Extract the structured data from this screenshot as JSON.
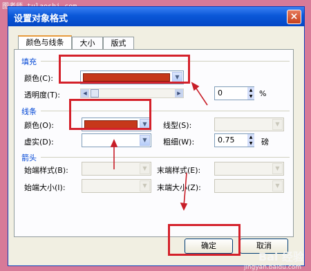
{
  "watermark": {
    "site": "图老师 tulaoshi.com",
    "brand": "Bai 经验",
    "url": "jingyan.baidu.com"
  },
  "dialog": {
    "title": "设置对象格式",
    "close_glyph": "×",
    "tabs": [
      {
        "label": "颜色与线条",
        "active": true
      },
      {
        "label": "大小",
        "active": false
      },
      {
        "label": "版式",
        "active": false
      }
    ],
    "fill": {
      "group": "填充",
      "color_label": "颜色(C):",
      "color_value": "#c6381a",
      "transparency_label": "透明度(T):",
      "transparency_value": "0",
      "transparency_unit": "%"
    },
    "line": {
      "group": "线条",
      "color_label": "颜色(O):",
      "color_value": "#c6381a",
      "style_label": "线型(S):",
      "dash_label": "虚实(D):",
      "weight_label": "粗细(W):",
      "weight_value": "0.75",
      "weight_unit": "磅"
    },
    "arrows": {
      "group": "箭头",
      "begin_style_label": "始端样式(B):",
      "end_style_label": "末端样式(E):",
      "begin_size_label": "始端大小(I):",
      "end_size_label": "末端大小(Z):"
    },
    "buttons": {
      "ok": "确定",
      "cancel": "取消"
    }
  },
  "colors": {
    "accent_red": "#d4202a",
    "titlebar_blue": "#0a57d8",
    "swatch": "#c6381a"
  }
}
